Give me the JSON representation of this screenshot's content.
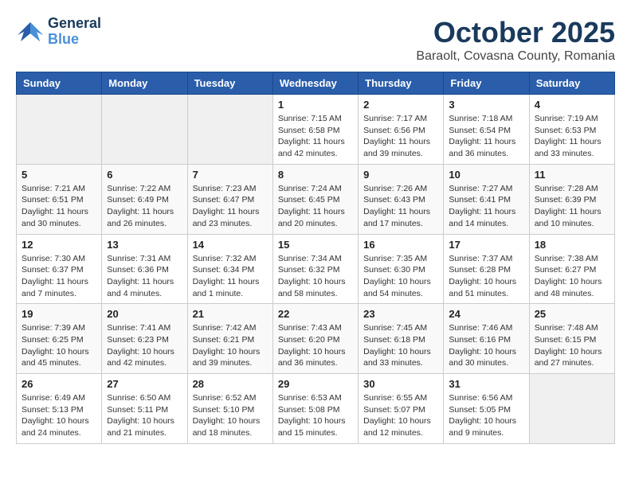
{
  "header": {
    "logo_general": "General",
    "logo_blue": "Blue",
    "month_title": "October 2025",
    "subtitle": "Baraolt, Covasna County, Romania"
  },
  "weekdays": [
    "Sunday",
    "Monday",
    "Tuesday",
    "Wednesday",
    "Thursday",
    "Friday",
    "Saturday"
  ],
  "weeks": [
    [
      {
        "day": "",
        "info": ""
      },
      {
        "day": "",
        "info": ""
      },
      {
        "day": "",
        "info": ""
      },
      {
        "day": "1",
        "info": "Sunrise: 7:15 AM\nSunset: 6:58 PM\nDaylight: 11 hours\nand 42 minutes."
      },
      {
        "day": "2",
        "info": "Sunrise: 7:17 AM\nSunset: 6:56 PM\nDaylight: 11 hours\nand 39 minutes."
      },
      {
        "day": "3",
        "info": "Sunrise: 7:18 AM\nSunset: 6:54 PM\nDaylight: 11 hours\nand 36 minutes."
      },
      {
        "day": "4",
        "info": "Sunrise: 7:19 AM\nSunset: 6:53 PM\nDaylight: 11 hours\nand 33 minutes."
      }
    ],
    [
      {
        "day": "5",
        "info": "Sunrise: 7:21 AM\nSunset: 6:51 PM\nDaylight: 11 hours\nand 30 minutes."
      },
      {
        "day": "6",
        "info": "Sunrise: 7:22 AM\nSunset: 6:49 PM\nDaylight: 11 hours\nand 26 minutes."
      },
      {
        "day": "7",
        "info": "Sunrise: 7:23 AM\nSunset: 6:47 PM\nDaylight: 11 hours\nand 23 minutes."
      },
      {
        "day": "8",
        "info": "Sunrise: 7:24 AM\nSunset: 6:45 PM\nDaylight: 11 hours\nand 20 minutes."
      },
      {
        "day": "9",
        "info": "Sunrise: 7:26 AM\nSunset: 6:43 PM\nDaylight: 11 hours\nand 17 minutes."
      },
      {
        "day": "10",
        "info": "Sunrise: 7:27 AM\nSunset: 6:41 PM\nDaylight: 11 hours\nand 14 minutes."
      },
      {
        "day": "11",
        "info": "Sunrise: 7:28 AM\nSunset: 6:39 PM\nDaylight: 11 hours\nand 10 minutes."
      }
    ],
    [
      {
        "day": "12",
        "info": "Sunrise: 7:30 AM\nSunset: 6:37 PM\nDaylight: 11 hours\nand 7 minutes."
      },
      {
        "day": "13",
        "info": "Sunrise: 7:31 AM\nSunset: 6:36 PM\nDaylight: 11 hours\nand 4 minutes."
      },
      {
        "day": "14",
        "info": "Sunrise: 7:32 AM\nSunset: 6:34 PM\nDaylight: 11 hours\nand 1 minute."
      },
      {
        "day": "15",
        "info": "Sunrise: 7:34 AM\nSunset: 6:32 PM\nDaylight: 10 hours\nand 58 minutes."
      },
      {
        "day": "16",
        "info": "Sunrise: 7:35 AM\nSunset: 6:30 PM\nDaylight: 10 hours\nand 54 minutes."
      },
      {
        "day": "17",
        "info": "Sunrise: 7:37 AM\nSunset: 6:28 PM\nDaylight: 10 hours\nand 51 minutes."
      },
      {
        "day": "18",
        "info": "Sunrise: 7:38 AM\nSunset: 6:27 PM\nDaylight: 10 hours\nand 48 minutes."
      }
    ],
    [
      {
        "day": "19",
        "info": "Sunrise: 7:39 AM\nSunset: 6:25 PM\nDaylight: 10 hours\nand 45 minutes."
      },
      {
        "day": "20",
        "info": "Sunrise: 7:41 AM\nSunset: 6:23 PM\nDaylight: 10 hours\nand 42 minutes."
      },
      {
        "day": "21",
        "info": "Sunrise: 7:42 AM\nSunset: 6:21 PM\nDaylight: 10 hours\nand 39 minutes."
      },
      {
        "day": "22",
        "info": "Sunrise: 7:43 AM\nSunset: 6:20 PM\nDaylight: 10 hours\nand 36 minutes."
      },
      {
        "day": "23",
        "info": "Sunrise: 7:45 AM\nSunset: 6:18 PM\nDaylight: 10 hours\nand 33 minutes."
      },
      {
        "day": "24",
        "info": "Sunrise: 7:46 AM\nSunset: 6:16 PM\nDaylight: 10 hours\nand 30 minutes."
      },
      {
        "day": "25",
        "info": "Sunrise: 7:48 AM\nSunset: 6:15 PM\nDaylight: 10 hours\nand 27 minutes."
      }
    ],
    [
      {
        "day": "26",
        "info": "Sunrise: 6:49 AM\nSunset: 5:13 PM\nDaylight: 10 hours\nand 24 minutes."
      },
      {
        "day": "27",
        "info": "Sunrise: 6:50 AM\nSunset: 5:11 PM\nDaylight: 10 hours\nand 21 minutes."
      },
      {
        "day": "28",
        "info": "Sunrise: 6:52 AM\nSunset: 5:10 PM\nDaylight: 10 hours\nand 18 minutes."
      },
      {
        "day": "29",
        "info": "Sunrise: 6:53 AM\nSunset: 5:08 PM\nDaylight: 10 hours\nand 15 minutes."
      },
      {
        "day": "30",
        "info": "Sunrise: 6:55 AM\nSunset: 5:07 PM\nDaylight: 10 hours\nand 12 minutes."
      },
      {
        "day": "31",
        "info": "Sunrise: 6:56 AM\nSunset: 5:05 PM\nDaylight: 10 hours\nand 9 minutes."
      },
      {
        "day": "",
        "info": ""
      }
    ]
  ]
}
